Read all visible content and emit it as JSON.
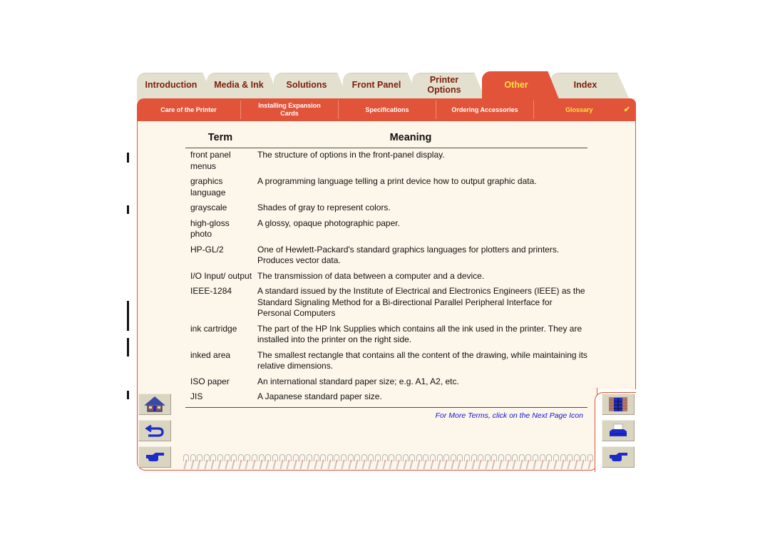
{
  "tabs": [
    {
      "label": "Introduction",
      "active": false
    },
    {
      "label": "Media & Ink",
      "active": false
    },
    {
      "label": "Solutions",
      "active": false
    },
    {
      "label": "Front Panel",
      "active": false
    },
    {
      "label": "Printer Options",
      "active": false
    },
    {
      "label": "Other",
      "active": true
    },
    {
      "label": "Index",
      "active": false
    }
  ],
  "subnav": [
    {
      "label": "Care of the Printer"
    },
    {
      "label": "Installing Expansion Cards"
    },
    {
      "label": "Specifications"
    },
    {
      "label": "Ordering Accessories"
    },
    {
      "label": "Glossary",
      "active": true,
      "mark": "✔"
    }
  ],
  "glossary": {
    "header_term": "Term",
    "header_meaning": "Meaning",
    "rows": [
      {
        "term": "front panel menus",
        "meaning": "The structure of options in the front-panel display."
      },
      {
        "term": "graphics language",
        "meaning": "A programming language telling a print device how to output graphic data."
      },
      {
        "term": "grayscale",
        "meaning": "Shades of gray to represent colors."
      },
      {
        "term": "high-gloss photo",
        "meaning": "A glossy, opaque photographic paper."
      },
      {
        "term": "HP-GL/2",
        "meaning": "One of Hewlett-Packard's standard graphics languages for plotters and printers. Produces vector data."
      },
      {
        "term": "I/O Input/ output",
        "meaning": "The transmission of data between a computer and a device."
      },
      {
        "term": "IEEE-1284",
        "meaning": "A standard issued by the Institute of Electrical and Electronics Engineers (IEEE) as the Standard Signaling Method for a Bi-directional Parallel Peripheral Interface for Personal Computers"
      },
      {
        "term": "ink cartridge",
        "meaning": "The part of the HP Ink Supplies which contains all the ink used in the printer. They are installed into the printer on the right side."
      },
      {
        "term": "inked area",
        "meaning": "The smallest rectangle that contains all the content of the drawing, while maintaining its relative dimensions."
      },
      {
        "term": "ISO paper",
        "meaning": "An international standard paper size; e.g. A1, A2, etc."
      },
      {
        "term": "JIS",
        "meaning": "A Japanese standard paper size."
      }
    ],
    "more_link": "For More Terms, click on the Next Page Icon"
  },
  "nav_buttons": {
    "left": [
      "home-icon",
      "back-icon",
      "next-page-icon"
    ],
    "right": [
      "contents-icon",
      "print-icon",
      "next-page-icon"
    ]
  },
  "colors": {
    "accent": "#e2543a",
    "active_text": "#f6e23a",
    "tab_inactive": "#e4e0cf",
    "tab_text": "#7a1e0a",
    "panel_bg": "#fdf6ea",
    "link": "#1414d8"
  }
}
